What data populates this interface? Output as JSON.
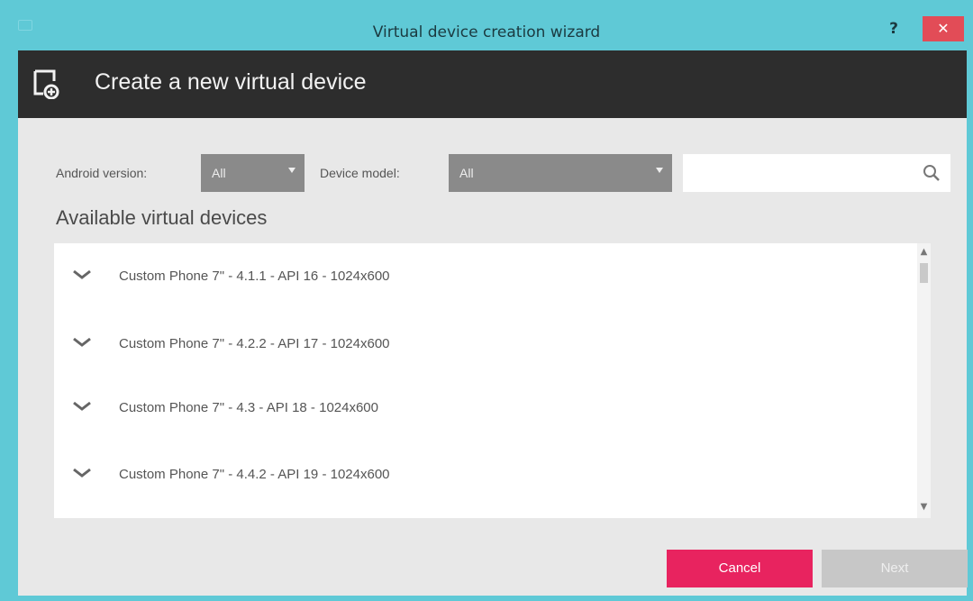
{
  "window": {
    "title": "Virtual device creation wizard",
    "help_label": "?",
    "close_label": "✕"
  },
  "header": {
    "title": "Create a new virtual device"
  },
  "filters": {
    "android_version_label": "Android version:",
    "android_version_value": "All",
    "device_model_label": "Device model:",
    "device_model_value": "All",
    "search_value": ""
  },
  "devices": {
    "section_title": "Available virtual devices",
    "items": [
      {
        "label": "Custom Phone 7\" - 4.1.1 - API 16 - 1024x600"
      },
      {
        "label": "Custom Phone 7\" - 4.2.2 - API 17 - 1024x600"
      },
      {
        "label": "Custom Phone 7\" - 4.3 - API 18 - 1024x600"
      },
      {
        "label": "Custom Phone 7\" - 4.4.2 - API 19 - 1024x600"
      }
    ]
  },
  "buttons": {
    "cancel_label": "Cancel",
    "next_label": "Next"
  },
  "colors": {
    "titlebar": "#5fc9d6",
    "header": "#2d2d2d",
    "cancel": "#e8235f",
    "close": "#e24c57"
  }
}
